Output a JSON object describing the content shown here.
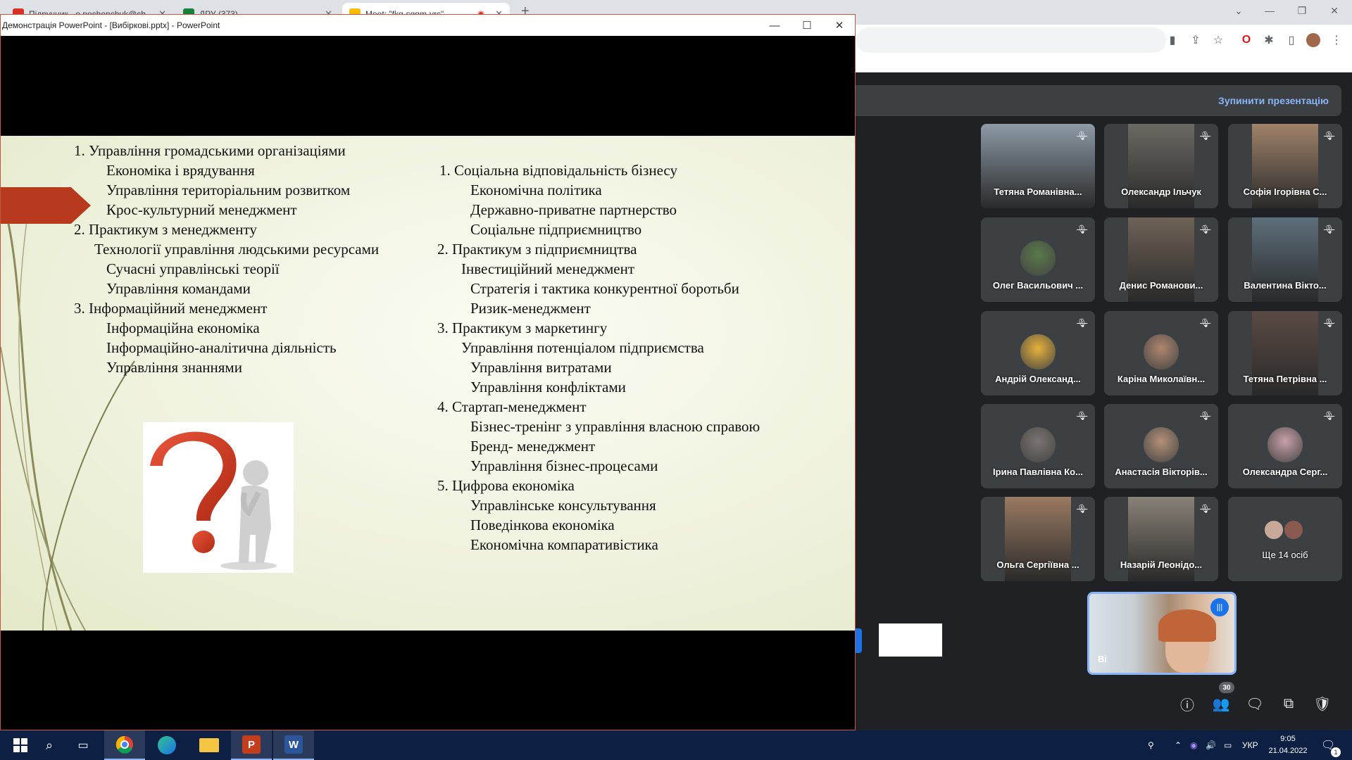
{
  "chrome": {
    "tabs": [
      {
        "title": "Підручник - o.pochenchuk@ch",
        "favicon_color": "#d93025"
      },
      {
        "title": "ДРУ (373)",
        "favicon_color": "#188038"
      },
      {
        "title": "Meet: \"fkq-sggm-vrc\"",
        "favicon_color": "#fbbc04"
      }
    ],
    "new_tab_glyph": "+"
  },
  "powerpoint": {
    "window_title": "Демонстрація PowerPoint - [Вибіркові.pptx] - PowerPoint",
    "slide": {
      "left_column": [
        "1.   Управління громадськими організаціями",
        "Економіка і врядування",
        "Управління територіальним розвитком",
        "Крос-культурний менеджмент",
        "2. Практикум з менеджменту",
        "Технології управління людськими ресурсами",
        "Сучасні управлінські теорії",
        "Управління командами",
        "3.  Інформаційний менеджмент",
        "Інформаційна економіка",
        "Інформаційно-аналітична діяльність",
        "Управління знаннями"
      ],
      "right_column": [
        "1.   Соціальна відповідальність бізнесу",
        "Економічна політика",
        "Державно-приватне партнерство",
        "Соціальне підприємництво",
        "2. Практикум з підприємництва",
        "Інвестиційний менеджмент",
        "Стратегія і тактика конкурентної боротьби",
        "Ризик-менеджмент",
        "3. Практикум з маркетингу",
        "Управління потенціалом підприємства",
        "Управління витратами",
        "Управління конфліктами",
        "4.  Стартап-менеджмент",
        "Бізнес-тренінг з управління власною справою",
        "Бренд- менеджмент",
        "Управління бізнес-процесами",
        "5.  Цифрова економіка",
        "Управлінське консультування",
        "Поведінкова економіка",
        "Економічна компаративістика"
      ]
    }
  },
  "meet": {
    "stop_presenting": "Зупинити презентацію",
    "participants": [
      {
        "name": "Тетяна Романівна...",
        "color": "#8c9aa6"
      },
      {
        "name": "Олександр Ільчук",
        "color": "#6b6a63"
      },
      {
        "name": "Софія Ігорівна С...",
        "color": "#a0836a"
      },
      {
        "name": "Олег Васильович ...",
        "color": "#5a7a4a"
      },
      {
        "name": "Денис Романови...",
        "color": "#6e6256"
      },
      {
        "name": "Валентина Вікто...",
        "color": "#5d6f7b"
      },
      {
        "name": "Андрій Олександ...",
        "color": "#e7b23c"
      },
      {
        "name": "Каріна Миколаївн...",
        "color": "#b0866e"
      },
      {
        "name": "Тетяна Петрівна ...",
        "color": "#5a4a44"
      },
      {
        "name": "Ірина Павлівна Ко...",
        "color": "#7a7470"
      },
      {
        "name": "Анастасія Вікторів...",
        "color": "#b49078"
      },
      {
        "name": "Олександра Серг...",
        "color": "#c8a0a8"
      },
      {
        "name": "Ольга Сергіївна ...",
        "color": "#9a7a62"
      },
      {
        "name": "Назарій Леонідо...",
        "color": "#8a8278"
      }
    ],
    "more_label": "Ще 14 осіб",
    "self_label": "Ві",
    "people_count": "30"
  },
  "taskbar": {
    "language": "УКР",
    "time": "9:05",
    "date": "21.04.2022",
    "notifications": "1"
  }
}
